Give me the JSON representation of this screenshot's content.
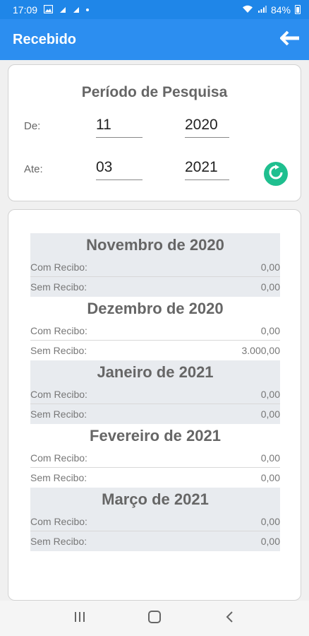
{
  "status_bar": {
    "time": "17:09",
    "battery_text": "84%",
    "icons": [
      "image-icon",
      "notification-icon",
      "notification-icon",
      "dot-icon",
      "wifi-icon",
      "signal-icon",
      "battery-icon"
    ]
  },
  "app_bar": {
    "title": "Recebido",
    "back_icon": "arrow-left-icon"
  },
  "period": {
    "title": "Período de Pesquisa",
    "from_label": "De:",
    "to_label": "Ate:",
    "from_month": "11",
    "from_year": "2020",
    "to_month": "03",
    "to_year": "2021",
    "refresh_icon": "refresh-icon"
  },
  "months": [
    {
      "title": "Novembro de 2020",
      "rows": [
        {
          "label": "Com Recibo:",
          "value": "0,00"
        },
        {
          "label": "Sem Recibo:",
          "value": "0,00"
        }
      ]
    },
    {
      "title": "Dezembro de 2020",
      "rows": [
        {
          "label": "Com Recibo:",
          "value": "0,00"
        },
        {
          "label": "Sem Recibo:",
          "value": "3.000,00"
        }
      ]
    },
    {
      "title": "Janeiro de 2021",
      "rows": [
        {
          "label": "Com Recibo:",
          "value": "0,00"
        },
        {
          "label": "Sem Recibo:",
          "value": "0,00"
        }
      ]
    },
    {
      "title": "Fevereiro de 2021",
      "rows": [
        {
          "label": "Com Recibo:",
          "value": "0,00"
        },
        {
          "label": "Sem Recibo:",
          "value": "0,00"
        }
      ]
    },
    {
      "title": "Março de 2021",
      "rows": [
        {
          "label": "Com Recibo:",
          "value": "0,00"
        },
        {
          "label": "Sem Recibo:",
          "value": "0,00"
        }
      ]
    }
  ],
  "colors": {
    "status_bar": "#1f86e8",
    "app_bar": "#2c8ef0",
    "refresh_button": "#1fbf8f",
    "shaded_block": "#e8ebef"
  },
  "nav_bar": {
    "icons": [
      "recent-apps-icon",
      "home-icon",
      "back-icon"
    ]
  }
}
